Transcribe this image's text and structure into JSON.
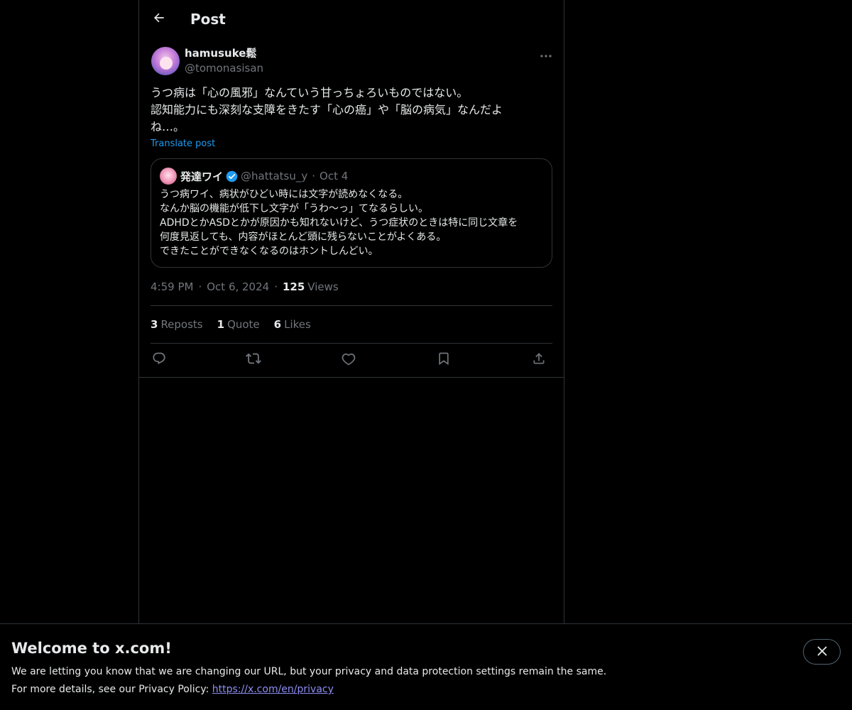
{
  "header": {
    "title": "Post"
  },
  "post": {
    "author_name": "hamusuke鬆",
    "author_handle": "@tomonasisan",
    "text": "うつ病は「心の風邪」なんていう甘っちょろいものではない。\n認知能力にも深刻な支障をきたす「心の癌」や「脳の病気」なんだよ\nね…。",
    "translate_label": "Translate post",
    "time": "4:59 PM",
    "date": "Oct 6, 2024",
    "views_count": "125",
    "views_label": "Views"
  },
  "quote": {
    "name": "発達ワイ",
    "handle": "@hattatsu_y",
    "date": "Oct 4",
    "text": "うつ病ワイ、病状がひどい時には文字が読めなくなる。\nなんか脳の機能が低下し文字が「うわ〜っ」てなるらしい。\nADHDとかASDとかが原因かも知れないけど、うつ症状のときは特に同じ文章を\n何度見返しても、内容がほとんど頭に残らないことがよくある。\nできたことができなくなるのはホントしんどい。"
  },
  "stats": {
    "reposts_count": "3",
    "reposts_label": "Reposts",
    "quote_count": "1",
    "quote_label": "Quote",
    "likes_count": "6",
    "likes_label": "Likes"
  },
  "actions": [
    "reply-icon",
    "repost-icon",
    "like-icon",
    "bookmark-icon",
    "share-icon"
  ],
  "banner": {
    "title": "Welcome to x.com!",
    "line1": "We are letting you know that we are changing our URL, but your privacy and data protection settings remain the same.",
    "line2_prefix": "For more details, see our Privacy Policy: ",
    "link": "https://x.com/en/privacy"
  },
  "colors": {
    "background": "#000000",
    "text": "#e7e9ea",
    "muted": "#71767b",
    "accent": "#1d9bf0",
    "border": "#2f3336",
    "link": "#8e8ef5"
  }
}
